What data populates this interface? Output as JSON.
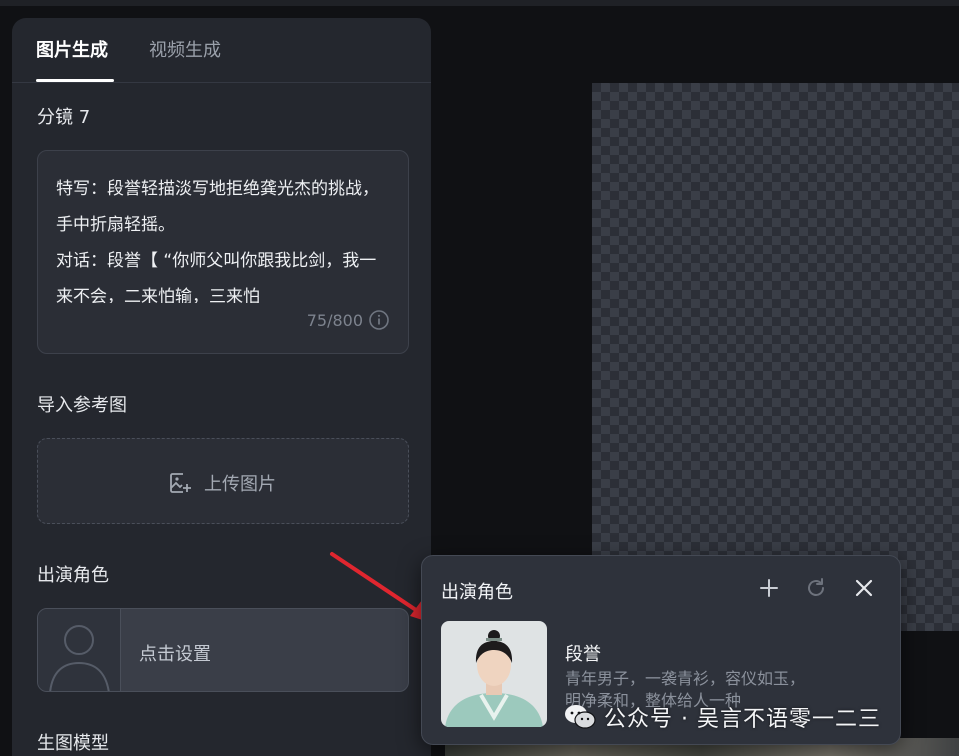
{
  "tabs": [
    {
      "label": "图片生成",
      "active": true
    },
    {
      "label": "视频生成",
      "active": false
    }
  ],
  "storyboard": {
    "title": "分镜 7",
    "text": "特写：段誉轻描淡写地拒绝龚光杰的挑战，手中折扇轻摇。\n对话：段誉【 “你师父叫你跟我比剑，我一来不会，二来怕输，三来怕",
    "char_count": "75/800"
  },
  "reference": {
    "title": "导入参考图",
    "upload_label": "上传图片"
  },
  "cast": {
    "title": "出演角色",
    "set_label": "点击设置"
  },
  "model": {
    "title": "生图模型"
  },
  "popup": {
    "title": "出演角色",
    "character": {
      "name": "段誉",
      "description": "青年男子，一袭青衫，容仪如玉，明净柔和，整体给人一种"
    }
  },
  "watermark": {
    "text": "公众号 · 吴言不语零一二三"
  },
  "colors": {
    "accent_arrow": "#e0262f",
    "panel_bg": "#24272e",
    "page_bg": "#101114"
  },
  "icons": [
    "info-icon",
    "upload-image-icon",
    "avatar-placeholder-icon",
    "plus-icon",
    "refresh-icon",
    "close-icon",
    "wechat-icon"
  ]
}
